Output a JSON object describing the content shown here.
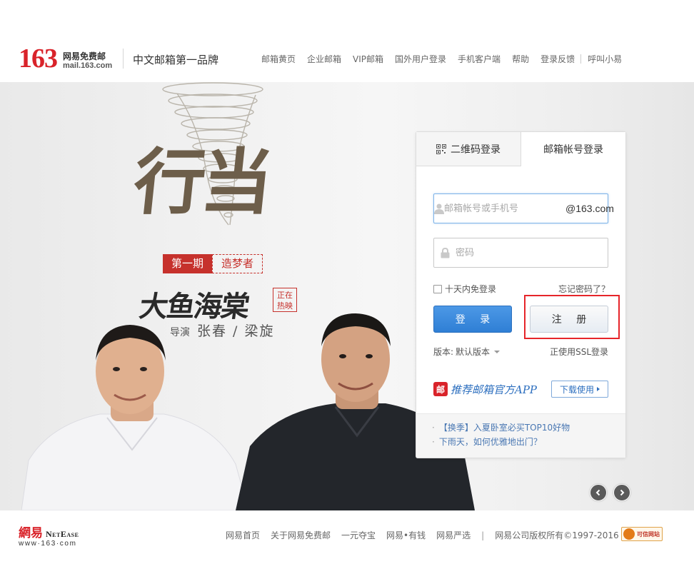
{
  "header": {
    "logo_number": "163",
    "logo_name": "网易免费邮",
    "logo_domain": "mail.163.com",
    "slogan": "中文邮箱第一品牌",
    "nav": [
      "邮箱黄页",
      "企业邮箱",
      "VIP邮箱",
      "国外用户登录",
      "手机客户端",
      "帮助",
      "登录反馈",
      "呼叫小易"
    ]
  },
  "banner": {
    "headline": "行当",
    "episode_number": "第一期",
    "episode_title": "造梦者",
    "film_title": "大鱼海棠",
    "now_showing": "正在热映",
    "director_label": "导演",
    "director_names": "张春 / 梁旋"
  },
  "login": {
    "tab_qr": "二维码登录",
    "tab_account": "邮箱帐号登录",
    "account_placeholder": "邮箱帐号或手机号",
    "account_suffix": "@163.com",
    "password_placeholder": "密码",
    "remember_label": "十天内免登录",
    "forgot_label": "忘记密码了？",
    "login_button": "登 录",
    "register_button": "注 册",
    "version_label": "版本:",
    "version_value": "默认版本",
    "ssl_label": "正使用SSL登录",
    "app_badge": "邮",
    "app_promo": "推荐邮箱官方APP",
    "download_button": "下载使用",
    "news": [
      "【换季】入夏卧室必买TOP10好物",
      "下雨天，如何优雅地出门？"
    ]
  },
  "footer": {
    "logo_cn": "網易",
    "logo_en": "NetEase",
    "logo_www": "www·163·com",
    "links": [
      "网易首页",
      "关于网易免费邮",
      "一元夺宝",
      "网易•有钱",
      "网易严选"
    ],
    "copyright": "网易公司版权所有©1997-2016",
    "trust_badge": "可信网站"
  },
  "colors": {
    "brand_red": "#d9232a",
    "login_blue": "#2f7fd5",
    "highlight_red": "#e6252a"
  }
}
